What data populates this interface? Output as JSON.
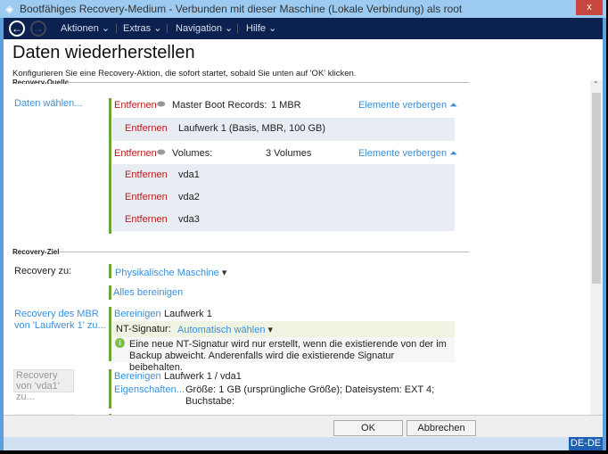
{
  "window": {
    "title": "Bootfähiges Recovery-Medium - Verbunden mit dieser Maschine (Lokale Verbindung) als root",
    "close": "x"
  },
  "nav": {
    "back": "←",
    "forward": "→",
    "menus": [
      "Aktionen",
      "Extras",
      "Navigation",
      "Hilfe"
    ]
  },
  "page": {
    "title": "Daten wiederherstellen",
    "subtitle": "Konfigurieren Sie eine Recovery-Aktion, die sofort startet, sobald Sie unten auf 'OK' klicken."
  },
  "source": {
    "section": "Recovery-Quelle",
    "select_link": "Daten wählen...",
    "mbr": {
      "remove": "Entfernen",
      "label": "Master Boot Records:",
      "count": "1 MBR",
      "toggle": "Elemente verbergen",
      "items": [
        {
          "remove": "Entfernen",
          "name": "Laufwerk 1 (Basis, MBR, 100 GB)"
        }
      ]
    },
    "volumes": {
      "remove": "Entfernen",
      "label": "Volumes:",
      "count": "3 Volumes",
      "toggle": "Elemente verbergen",
      "items": [
        {
          "remove": "Entfernen",
          "name": "vda1"
        },
        {
          "remove": "Entfernen",
          "name": "vda2"
        },
        {
          "remove": "Entfernen",
          "name": "vda3"
        }
      ]
    }
  },
  "target": {
    "section": "Recovery-Ziel",
    "recovery_to_label": "Recovery zu:",
    "recovery_to_value": "Physikalische Maschine",
    "clear_all": "Alles bereinigen",
    "mbr_link": "Recovery des MBR von 'Laufwerk 1' zu...",
    "mbr_clear": "Bereinigen",
    "mbr_disk": "Laufwerk 1",
    "nt_label": "NT-Signatur:",
    "nt_value": "Automatisch wählen",
    "nt_info": "Eine neue NT-Signatur wird nur erstellt, wenn die existierende von der im Backup abweicht. Anderenfalls wird die existierende Signatur beibehalten.",
    "vol_button": "Recovery von 'vda1' zu...",
    "vol_clear": "Bereinigen",
    "vol_disk": "Laufwerk 1 / vda1",
    "vol_props": "Eigenschaften...",
    "vol_details": "Größe: 1 GB (ursprüngliche Größe); Dateisystem: EXT 4; Buchstabe:"
  },
  "footer": {
    "ok": "OK",
    "cancel": "Abbrechen"
  },
  "status": {
    "lang": "DE-DE"
  }
}
